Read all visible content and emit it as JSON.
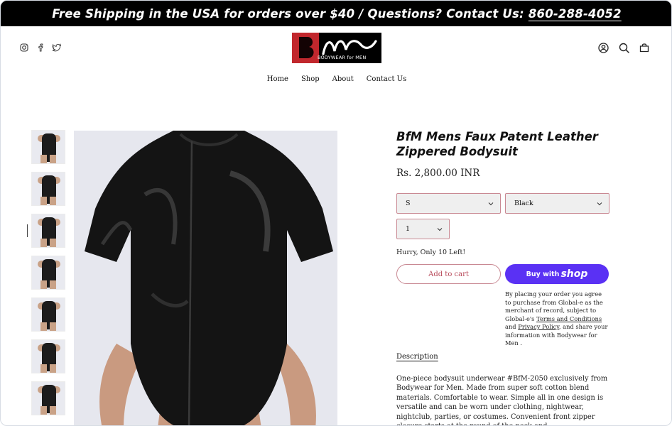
{
  "announcement": {
    "text": "Free Shipping in the USA for orders over $40 / Questions? Contact Us:",
    "phone": "860-288-4052"
  },
  "social": [
    "instagram-icon",
    "facebook-icon",
    "twitter-icon"
  ],
  "logo": {
    "tagline": "BODYWEAR for MEN",
    "colors": {
      "red": "#c1272d",
      "black": "#000000"
    }
  },
  "header_icons": [
    "account-icon",
    "search-icon",
    "cart-icon"
  ],
  "nav": [
    {
      "label": "Home"
    },
    {
      "label": "Shop"
    },
    {
      "label": "About"
    },
    {
      "label": "Contact Us"
    }
  ],
  "gallery": {
    "thumb_count": 7,
    "active_index": 2
  },
  "product": {
    "title": "BfM Mens Faux Patent Leather Zippered Bodysuit",
    "price": "Rs. 2,800.00 INR",
    "size": "S",
    "color": "Black",
    "quantity": "1",
    "stock": "Hurry, Only 10 Left!",
    "add_to_cart": "Add to cart",
    "buy_with": "Buy with",
    "shop": "shop"
  },
  "legal": {
    "part1": "By placing your order you agree to purchase from Global-e as the merchant of record, subject to Global-e's",
    "terms": "Terms and Conditions",
    "and": "and",
    "privacy": "Privacy Policy",
    "part2": ", and share your information with Bodywear for Men ."
  },
  "description": {
    "tab": "Description",
    "text": "One-piece bodysuit underwear #BfM-2050 exclusively from Bodywear for Men. Made from super soft cotton blend materials. Comfortable to wear. Simple all in one design is versatile and can be worn under clothing, nightwear, nightclub, parties, or costumes. Convenient front zipper closure starts at the round of the neck and"
  },
  "colors": {
    "accent": "#5a31f4",
    "border_pink": "#c98993",
    "cart_text": "#b84a5a"
  }
}
